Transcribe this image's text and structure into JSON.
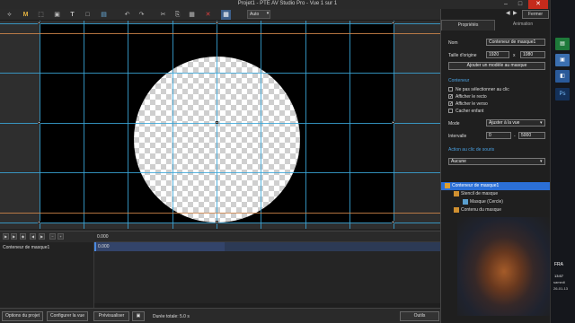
{
  "window": {
    "title": "Projet1 - PTE AV Studio Pro - Vue 1 sur 1",
    "minimize": "–",
    "maximize": "□",
    "close": "✕"
  },
  "toolbar": {
    "tools": [
      "select-tool",
      "mask-tool",
      "crop-tool",
      "picture-tool",
      "text-tool",
      "rectangle-tool",
      "image-tool",
      "undo",
      "redo",
      "cut",
      "copy",
      "paste",
      "delete",
      "grid-toggle"
    ],
    "zoom_value": "Auto",
    "zoom_arrow": "▾"
  },
  "panel": {
    "nav_prev": "◀",
    "nav_next": "▶",
    "close_label": "Fermer",
    "tabs": [
      "Propriétés",
      "Animation"
    ],
    "name_label": "Nom",
    "name_value": "Conteneur de masque1",
    "size_label": "Taille d'origine",
    "width_value": "1920",
    "times": "x",
    "height_value": "1080",
    "add_model_label": "Ajouter un modèle au masque",
    "section_container": "Conteneur",
    "check_no_select": "Ne pas sélectionner au clic",
    "check_recto": "Afficher le recto",
    "check_verso": "Afficher le verso",
    "check_hide_child": "Cacher enfant",
    "check_mark": "✓",
    "mode_label": "Mode",
    "mode_value": "Ajuster à la vue",
    "interval_label": "Intervalle",
    "interval_from": "0",
    "interval_dash": "-",
    "interval_to": "5000",
    "section_click": "Action au clic de souris",
    "click_value": "Aucune",
    "dropdown_arrow": "▾",
    "tree": [
      {
        "label": "Conteneur de masque1",
        "selected": true
      },
      {
        "label": "Stencil de masque",
        "selected": false
      },
      {
        "label": "Masque (Cercle)",
        "selected": false
      },
      {
        "label": "Contenu du masque",
        "selected": false
      }
    ]
  },
  "timeline": {
    "ruler_value": "0.000",
    "track_name": "Conteneur de masque1",
    "track_value": "0.000"
  },
  "bottombar": {
    "project_options": "Options du projet",
    "configure_view": "Configurer la vue",
    "preview": "Prévisualiser",
    "duration": "Durée totale: 5.0 s",
    "tools": "Outils"
  },
  "taskbar": {
    "time": "13:57",
    "day": "samedi",
    "date": "26-01-13",
    "lang": "FRA"
  }
}
